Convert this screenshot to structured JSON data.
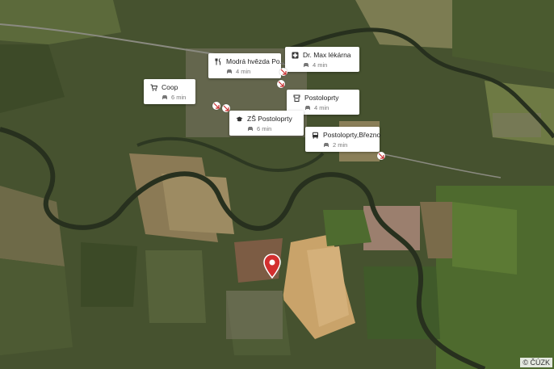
{
  "map": {
    "copyright": "© ČÚZK",
    "accent_color": "#d32f2f"
  },
  "pois": [
    {
      "name": "Dr. Max lékárna",
      "time": "4 min",
      "icon": "pharmacy-cross-icon"
    },
    {
      "name": "Modrá hvězda Po...",
      "time": "4 min",
      "icon": "restaurant-cutlery-icon"
    },
    {
      "name": "Coop",
      "time": "6 min",
      "icon": "shopping-cart-icon"
    },
    {
      "name": "Postoloprty",
      "time": "4 min",
      "icon": "post-office-icon"
    },
    {
      "name": "ZŠ Postoloprty",
      "time": "6 min",
      "icon": "school-graduation-cap-icon"
    },
    {
      "name": "Postoloprty,Březno",
      "time": "2 min",
      "icon": "bus-icon"
    }
  ],
  "travel_mode_icon": "car-icon",
  "location_marker_icon": "map-pin-icon"
}
